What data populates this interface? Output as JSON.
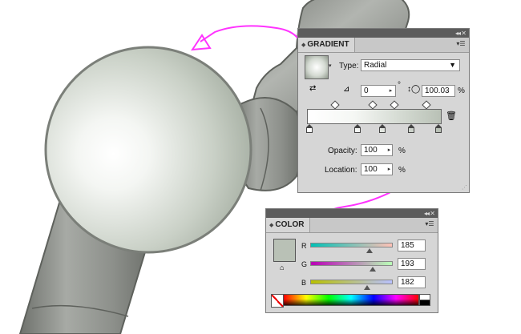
{
  "gradient_panel": {
    "tab_label": "GRADIENT",
    "type_label": "Type:",
    "type_value": "Radial",
    "angle_value": "0",
    "angle_unit": "°",
    "aspect_value": "100.03",
    "aspect_unit": "%",
    "opacity_label": "Opacity:",
    "opacity_value": "100",
    "location_label": "Location:",
    "location_value": "100",
    "percent": "%",
    "colors": {
      "start": "#ffffff",
      "end": "#b9c1b6"
    }
  },
  "color_panel": {
    "tab_label": "COLOR",
    "r_label": "R",
    "r_value": "185",
    "g_label": "G",
    "g_value": "193",
    "b_label": "B",
    "b_value": "182",
    "swatch_color": "#b9c1b6",
    "r_level": 0.725,
    "g_level": 0.757,
    "b_level": 0.714
  },
  "annotation_color": "#ff33ff",
  "icons": [
    "gradient-preview-swatch",
    "reverse-gradient-icon",
    "angle-icon",
    "aspect-ratio-icon",
    "delete-stop-icon",
    "panel-menu-icon",
    "collapse-icon",
    "none-color-icon"
  ]
}
